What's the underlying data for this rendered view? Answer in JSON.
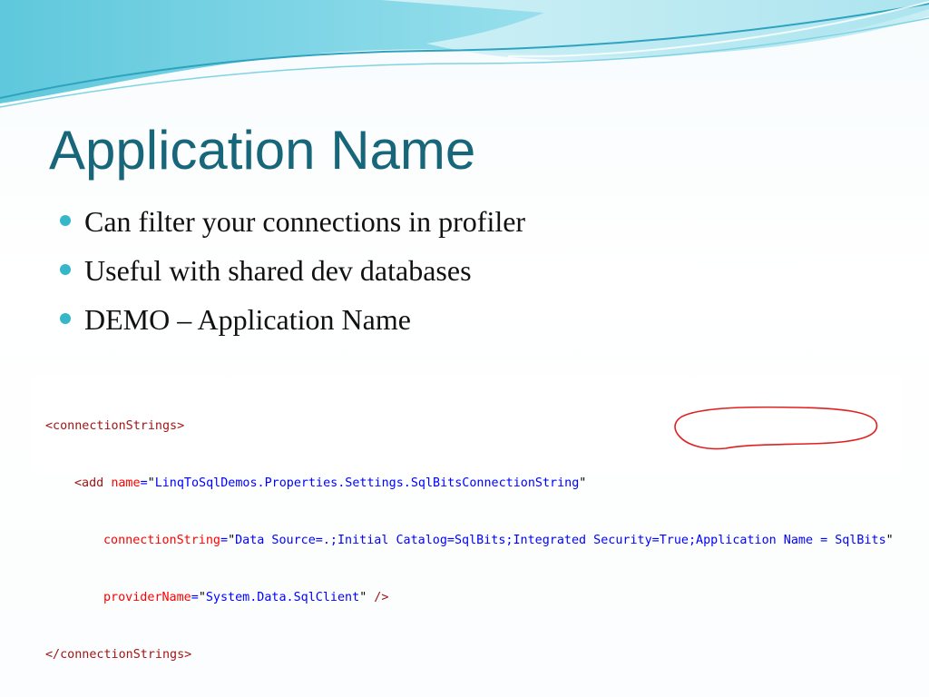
{
  "slide": {
    "title": "Application Name",
    "bullets": [
      "Can filter your connections in profiler",
      "Useful with shared dev databases",
      "DEMO – Application Name"
    ]
  },
  "code": {
    "line1": "<connectionStrings>",
    "line2_open": "<add ",
    "line2_attr": "name",
    "line2_value": "LinqToSqlDemos.Properties.Settings.SqlBitsConnectionString",
    "line3_attr": "connectionString",
    "line3_value_main": "Data Source=.;Initial Catalog=SqlBits;Integrated Security=True;",
    "line3_value_highlight": "Application Name = SqlBits",
    "line4_attr": "providerName",
    "line4_value": "System.Data.SqlClient",
    "line4_close": " />",
    "line5": "</connectionStrings>"
  },
  "colors": {
    "title": "#17667a",
    "bullet": "#36b7c9",
    "highlight_ellipse": "#e02020",
    "wave_light": "#bfe9f1",
    "wave_mid": "#6fd0e1",
    "wave_dark": "#2ea3bf"
  }
}
